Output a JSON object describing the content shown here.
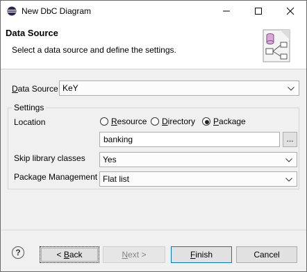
{
  "window": {
    "title": "New DbC Diagram"
  },
  "banner": {
    "title": "Data Source",
    "description": "Select a data source and define the settings."
  },
  "data_source": {
    "label_key": "D",
    "label_rest": "ata Source",
    "value": "KeY"
  },
  "settings": {
    "group_title": "Settings",
    "location_label": "Location",
    "location_options": [
      {
        "key": "R",
        "rest": "esource",
        "selected": false
      },
      {
        "key": "D",
        "rest": "irectory",
        "selected": false
      },
      {
        "key": "P",
        "rest": "ackage",
        "selected": true
      }
    ],
    "location_value": "banking",
    "browse_label": "...",
    "skip_label": "Skip library classes",
    "skip_value": "Yes",
    "pkg_label": "Package Management",
    "pkg_value": "Flat list"
  },
  "footer": {
    "help_label": "?",
    "back": {
      "pre": "< ",
      "key": "B",
      "rest": "ack"
    },
    "next": {
      "key": "N",
      "rest": "ext >"
    },
    "finish": {
      "key": "F",
      "rest": "inish"
    },
    "cancel": "Cancel"
  }
}
